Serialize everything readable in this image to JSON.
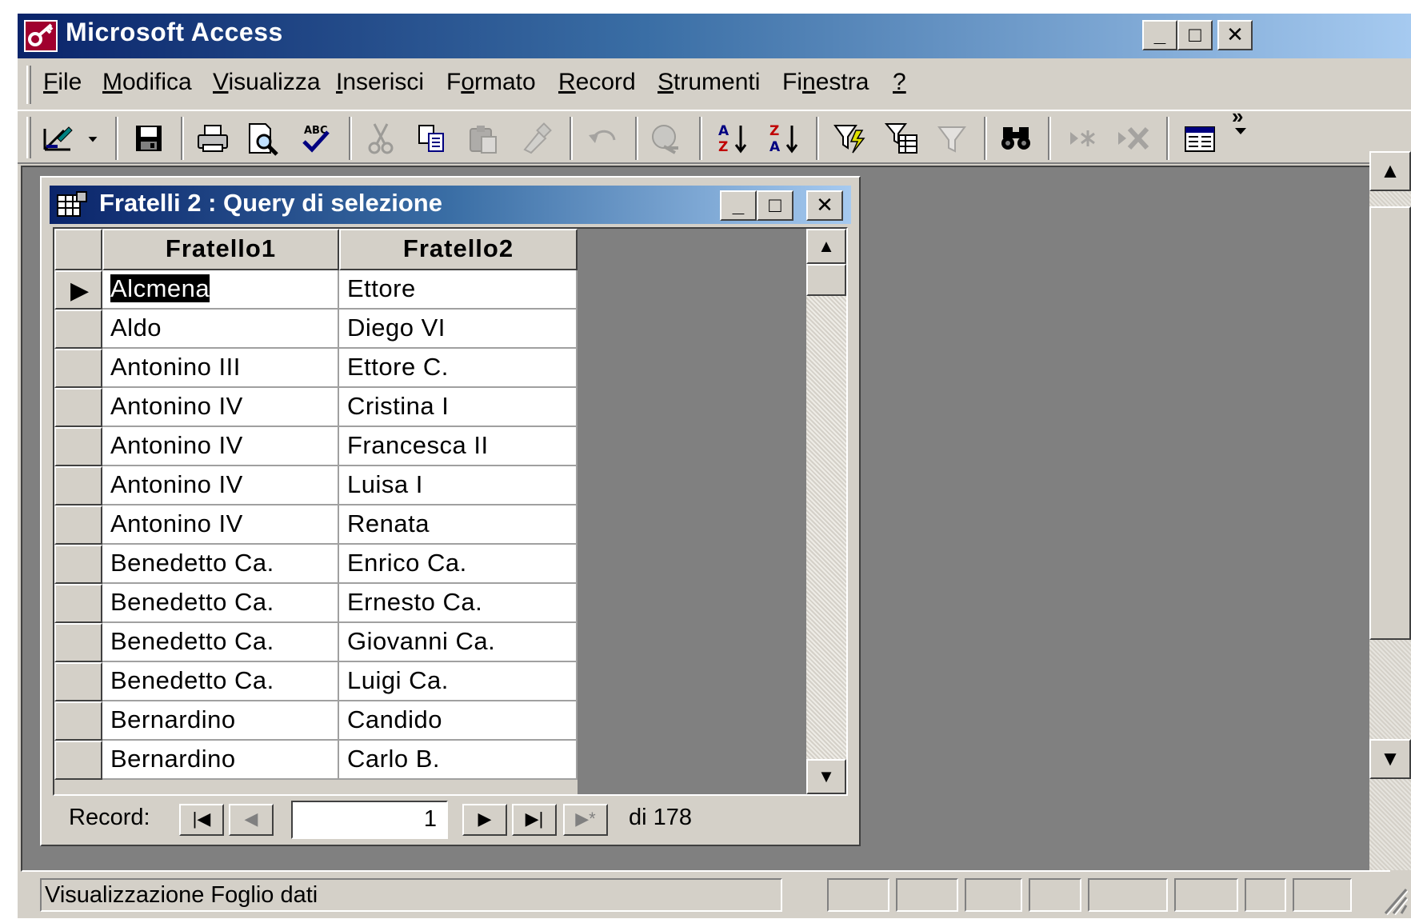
{
  "app": {
    "title": "Microsoft Access",
    "caption_buttons": {
      "minimize": "_",
      "maximize": "□",
      "close": "✕"
    }
  },
  "menu": [
    {
      "label": "File",
      "accel": "F",
      "rest": "ile",
      "pre": ""
    },
    {
      "label": "Modifica",
      "accel": "M",
      "rest": "odifica",
      "pre": ""
    },
    {
      "label": "Visualizza",
      "accel": "V",
      "rest": "isualizza",
      "pre": ""
    },
    {
      "label": "Inserisci",
      "accel": "I",
      "rest": "nserisci",
      "pre": ""
    },
    {
      "label": "Formato",
      "accel": "o",
      "rest": "rmato",
      "pre": "F"
    },
    {
      "label": "Record",
      "accel": "R",
      "rest": "ecord",
      "pre": ""
    },
    {
      "label": "Strumenti",
      "accel": "S",
      "rest": "trumenti",
      "pre": ""
    },
    {
      "label": "Finestra",
      "accel": "n",
      "rest": "estra",
      "pre": "Fi"
    },
    {
      "label": "?",
      "accel": "?",
      "rest": "",
      "pre": ""
    }
  ],
  "toolbar": {
    "icons": [
      "design-view",
      "dropdown-arrow",
      "save",
      "print",
      "print-preview",
      "spelling",
      "cut",
      "copy",
      "paste",
      "format-painter",
      "undo",
      "insert-hyperlink",
      "sort-ascending",
      "sort-descending",
      "filter-by-selection",
      "filter-by-form",
      "apply-filter",
      "find",
      "new-record",
      "delete-record",
      "properties",
      "more-buttons"
    ],
    "overflow": "»"
  },
  "child_window": {
    "title": "Fratelli 2 : Query di selezione",
    "caption_buttons": {
      "minimize": "_",
      "maximize": "□",
      "close": "✕"
    }
  },
  "datasheet": {
    "columns": [
      "Fratello1",
      "Fratello2"
    ],
    "rows": [
      [
        "Alcmena",
        "Ettore"
      ],
      [
        "Aldo",
        "Diego VI"
      ],
      [
        "Antonino III",
        "Ettore C."
      ],
      [
        "Antonino IV",
        "Cristina I"
      ],
      [
        "Antonino IV",
        "Francesca II"
      ],
      [
        "Antonino IV",
        "Luisa I"
      ],
      [
        "Antonino IV",
        "Renata"
      ],
      [
        "Benedetto Ca.",
        "Enrico Ca."
      ],
      [
        "Benedetto Ca.",
        "Ernesto Ca."
      ],
      [
        "Benedetto Ca.",
        "Giovanni Ca."
      ],
      [
        "Benedetto Ca.",
        "Luigi Ca."
      ],
      [
        "Bernardino",
        "Candido"
      ],
      [
        "Bernardino",
        "Carlo B."
      ]
    ],
    "current_row_marker": "▶"
  },
  "navigation": {
    "label": "Record:",
    "current": "1",
    "of_text": "di 178",
    "buttons": {
      "first": "|◀",
      "prev": "◀",
      "next": "▶",
      "last": "▶|",
      "new": "▶*"
    }
  },
  "status": {
    "text": "Visualizzazione Foglio dati"
  },
  "colors": {
    "titlebar_start": "#0a246a",
    "titlebar_end": "#a6caf0",
    "face": "#d4d0c8",
    "mdi_background": "#808080"
  }
}
